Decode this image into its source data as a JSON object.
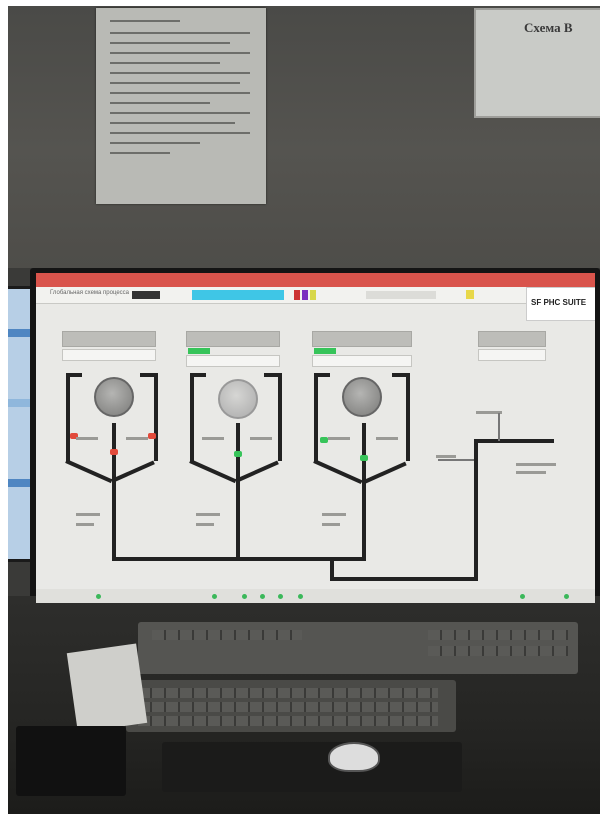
{
  "wall_sign": {
    "text": "Схема В"
  },
  "screen": {
    "window_title": "Глобальная схема процесса",
    "brand": "SF PHC SUITE",
    "colors": {
      "titlebar": "#d9544c",
      "toolbar_accent": "#3fc6e6",
      "status_ok": "#37c45a",
      "valve_alarm": "#e24a3b",
      "pipe": "#222222"
    },
    "vessels": [
      {
        "state": "active",
        "tag": false
      },
      {
        "state": "idle",
        "tag": true
      },
      {
        "state": "active",
        "tag": true
      }
    ]
  },
  "icons": [
    "vessel-icon",
    "valve-icon",
    "pipe-line",
    "status-dot-icon"
  ]
}
